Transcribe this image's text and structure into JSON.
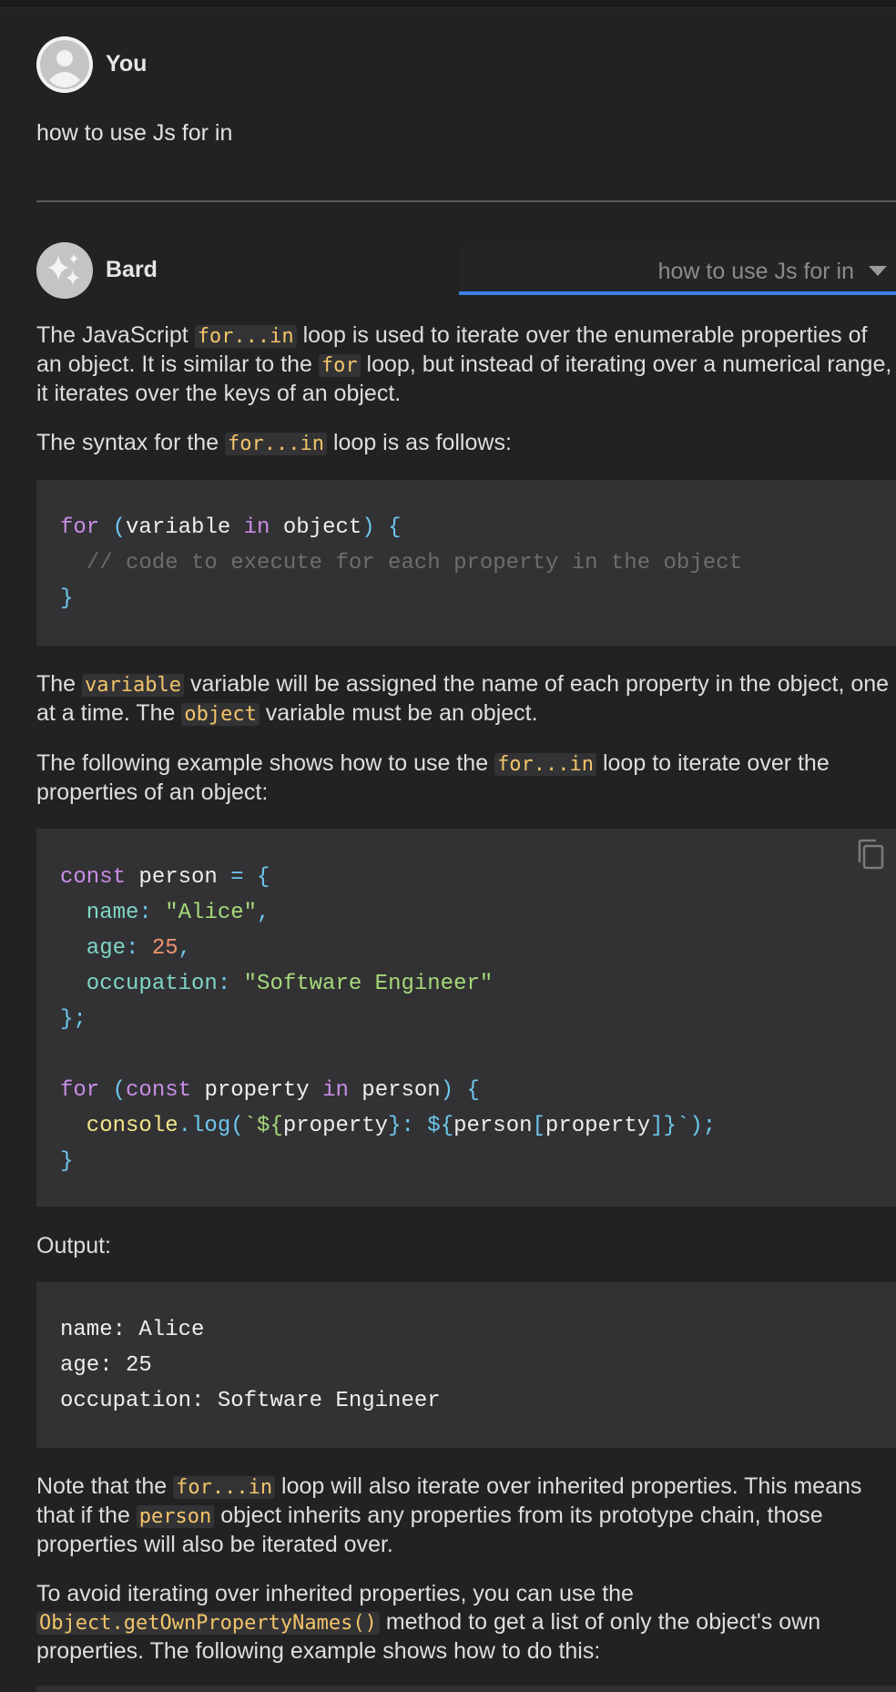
{
  "user": {
    "name": "You",
    "message": "how to use Js for in"
  },
  "assistant": {
    "name": "Bard",
    "draft_selector": "how to use Js for in"
  },
  "response": {
    "p1": {
      "a": "The JavaScript ",
      "c1": "for...in",
      "b": " loop is used to iterate over the enumerable properties of an object. It is similar to the ",
      "c2": "for",
      "c": " loop, but instead of iterating over a numerical range, it iterates over the keys of an object."
    },
    "p2": {
      "a": "The syntax for the ",
      "c1": "for...in",
      "b": " loop is as follows:"
    },
    "code1": {
      "l1_kw": "for",
      "l1_open": " (",
      "l1_var": "variable ",
      "l1_in": "in",
      "l1_obj": " object",
      "l1_close": ") {",
      "l2": "  // code to execute for each property in the object",
      "l3": "}"
    },
    "p3": {
      "a": "The ",
      "c1": "variable",
      "b": " variable will be assigned the name of each property in the object, one at a time. The ",
      "c2": "object",
      "c": " variable must be an object."
    },
    "p4": {
      "a": "The following example shows how to use the ",
      "c1": "for...in",
      "b": " loop to iterate over the properties of an object:"
    },
    "code2": {
      "const_kw": "const",
      "person_decl": " person ",
      "eq": "= {",
      "name_key": "  name",
      "name_colon": ": ",
      "name_val": "\"Alice\"",
      "comma1": ",",
      "age_key": "  age",
      "age_colon": ": ",
      "age_val": "25",
      "comma2": ",",
      "occ_key": "  occupation",
      "occ_colon": ": ",
      "occ_val": "\"Software Engineer\"",
      "close_obj": "};",
      "for_kw": "for",
      "for_open": " (",
      "const2": "const",
      "prop_var": " property ",
      "in_kw": "in",
      "person_ref": " person",
      "for_close": ") {",
      "console": "  console",
      "dot_log": ".log(",
      "tpl": "`${",
      "tpl_prop": "property",
      "tpl_mid": "}: ${",
      "tpl_person": "person",
      "tpl_lb": "[",
      "tpl_prop2": "property",
      "tpl_rb": "]}`",
      "log_end": ");",
      "close_for": "}"
    },
    "output_label": "Output:",
    "code3": {
      "l1": "name: Alice",
      "l2": "age: 25",
      "l3": "occupation: Software Engineer"
    },
    "p5": {
      "a": "Note that the ",
      "c1": "for...in",
      "b": " loop will also iterate over inherited properties. This means that if the ",
      "c2": "person",
      "c": " object inherits any properties from its prototype chain, those properties will also be iterated over."
    },
    "p6": {
      "a": "To avoid iterating over inherited properties, you can use the ",
      "c1": "Object.getOwnPropertyNames()",
      "b": " method to get a list of only the object's own properties. The following example shows how to do this:"
    }
  },
  "icons": {
    "user_avatar": "person-avatar-icon",
    "bard_avatar": "sparkle-icon",
    "copy": "copy-icon",
    "dropdown": "chevron-down-icon"
  },
  "colors": {
    "background": "#222223",
    "code_background": "#323234",
    "inline_code": "#f4c46a",
    "accent": "#3d7de6"
  }
}
